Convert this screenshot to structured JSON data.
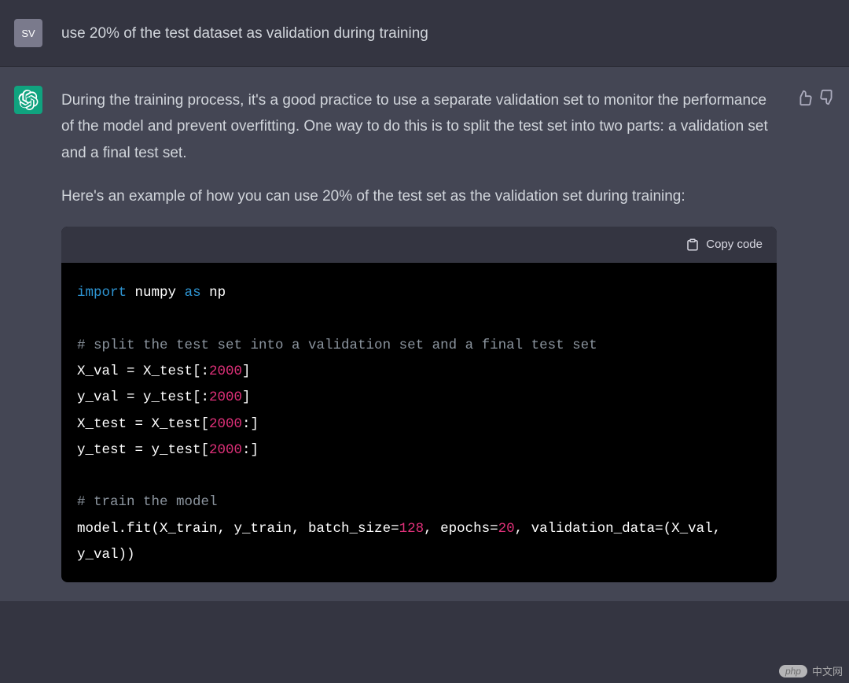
{
  "user": {
    "avatar_initials": "SV",
    "message": "use 20% of the test dataset as validation during training"
  },
  "assistant": {
    "paragraph1": "During the training process, it's a good practice to use a separate validation set to monitor the performance of the model and prevent overfitting. One way to do this is to split the test set into two parts: a validation set and a final test set.",
    "paragraph2": "Here's an example of how you can use 20% of the test set as the validation set during training:",
    "code": {
      "copy_label": "Copy code",
      "tokens": {
        "import": "import",
        "numpy": "numpy",
        "as": "as",
        "np": "np",
        "comment_split": "# split the test set into a validation set and a final test set",
        "l_xval": "X_val = X_test[:",
        "l_yval": "y_val = y_test[:",
        "l_xtest": "X_test = X_test[",
        "l_ytest": "y_test = y_test[",
        "close_bracket": "]",
        "colon_close": ":]",
        "n2000": "2000",
        "comment_train": "# train the model",
        "fit_a": "model.fit(X_train, y_train, batch_size=",
        "n128": "128",
        "fit_b": ", epochs=",
        "n20": "20",
        "fit_c": ", validation_data=(X_val, y_val))"
      }
    }
  },
  "watermark": {
    "pill": "php",
    "text": "中文网"
  }
}
